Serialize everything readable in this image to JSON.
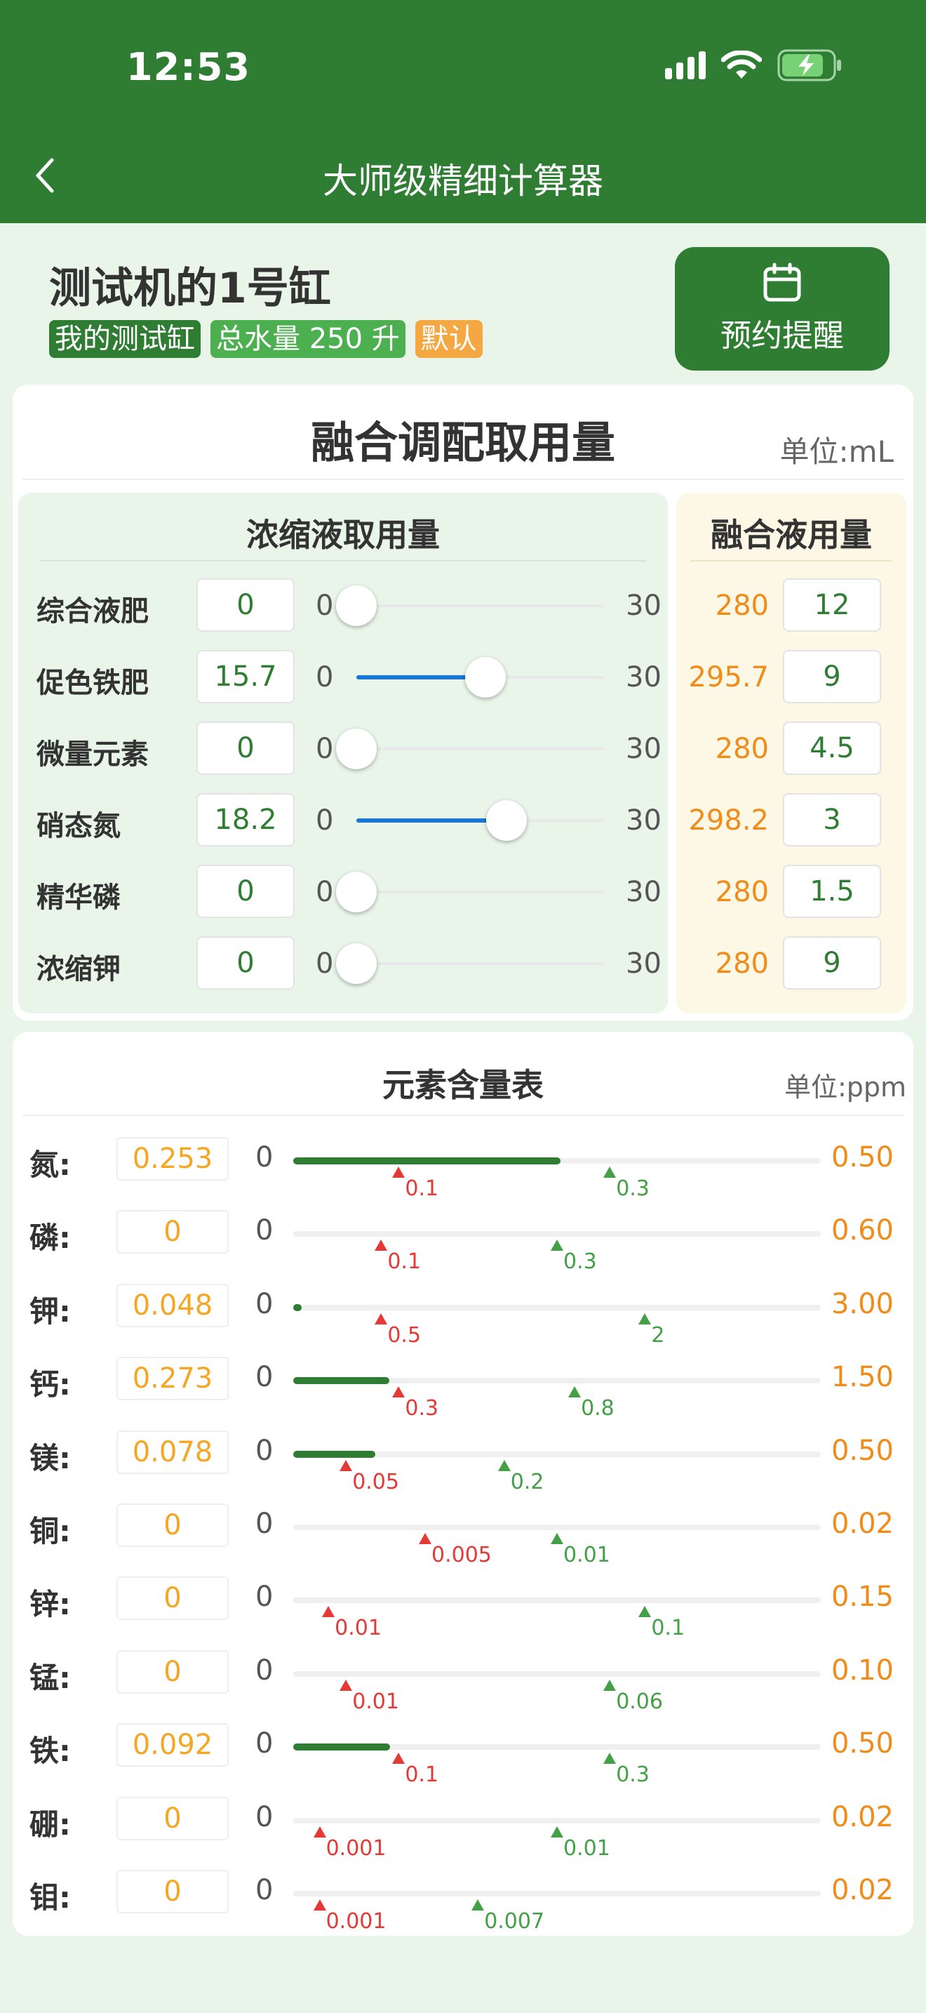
{
  "status": {
    "time": "12:53"
  },
  "header": {
    "title": "大师级精细计算器"
  },
  "tank": {
    "name": "测试机的1号缸",
    "tags": [
      "我的测试缸",
      "总水量 250 升",
      "默认"
    ],
    "reminder_label": "预约提醒"
  },
  "fusion": {
    "title": "融合调配取用量",
    "unit": "单位:mL",
    "conc_header": "浓缩液取用量",
    "fusion_header": "融合液用量",
    "rows": [
      {
        "name": "综合液肥",
        "value": "0",
        "min": "0",
        "max": "30",
        "level": 0,
        "total": "280",
        "fusion": "12"
      },
      {
        "name": "促色铁肥",
        "value": "15.7",
        "min": "0",
        "max": "30",
        "level": 15.7,
        "total": "295.7",
        "fusion": "9"
      },
      {
        "name": "微量元素",
        "value": "0",
        "min": "0",
        "max": "30",
        "level": 0,
        "total": "280",
        "fusion": "4.5"
      },
      {
        "name": "硝态氮",
        "value": "18.2",
        "min": "0",
        "max": "30",
        "level": 18.2,
        "total": "298.2",
        "fusion": "3"
      },
      {
        "name": "精华磷",
        "value": "0",
        "min": "0",
        "max": "30",
        "level": 0,
        "total": "280",
        "fusion": "1.5"
      },
      {
        "name": "浓缩钾",
        "value": "0",
        "min": "0",
        "max": "30",
        "level": 0,
        "total": "280",
        "fusion": "9"
      }
    ]
  },
  "elements": {
    "title": "元素含量表",
    "unit": "单位:ppm",
    "rows": [
      {
        "label": "氮:",
        "value": "0.253",
        "zero": "0",
        "max": "0.50",
        "level": 0.253,
        "low": "0.1",
        "high": "0.3"
      },
      {
        "label": "磷:",
        "value": "0",
        "zero": "0",
        "max": "0.60",
        "level": 0,
        "low": "0.1",
        "high": "0.3"
      },
      {
        "label": "钾:",
        "value": "0.048",
        "zero": "0",
        "max": "3.00",
        "level": 0.048,
        "low": "0.5",
        "high": "2"
      },
      {
        "label": "钙:",
        "value": "0.273",
        "zero": "0",
        "max": "1.50",
        "level": 0.273,
        "low": "0.3",
        "high": "0.8"
      },
      {
        "label": "镁:",
        "value": "0.078",
        "zero": "0",
        "max": "0.50",
        "level": 0.078,
        "low": "0.05",
        "high": "0.2"
      },
      {
        "label": "铜:",
        "value": "0",
        "zero": "0",
        "max": "0.02",
        "level": 0,
        "low": "0.005",
        "high": "0.01"
      },
      {
        "label": "锌:",
        "value": "0",
        "zero": "0",
        "max": "0.15",
        "level": 0,
        "low": "0.01",
        "high": "0.1"
      },
      {
        "label": "锰:",
        "value": "0",
        "zero": "0",
        "max": "0.10",
        "level": 0,
        "low": "0.01",
        "high": "0.06"
      },
      {
        "label": "铁:",
        "value": "0.092",
        "zero": "0",
        "max": "0.50",
        "level": 0.092,
        "low": "0.1",
        "high": "0.3"
      },
      {
        "label": "硼:",
        "value": "0",
        "zero": "0",
        "max": "0.02",
        "level": 0,
        "low": "0.001",
        "high": "0.01"
      },
      {
        "label": "钼:",
        "value": "0",
        "zero": "0",
        "max": "0.02",
        "level": 0,
        "low": "0.001",
        "high": "0.007"
      }
    ]
  }
}
